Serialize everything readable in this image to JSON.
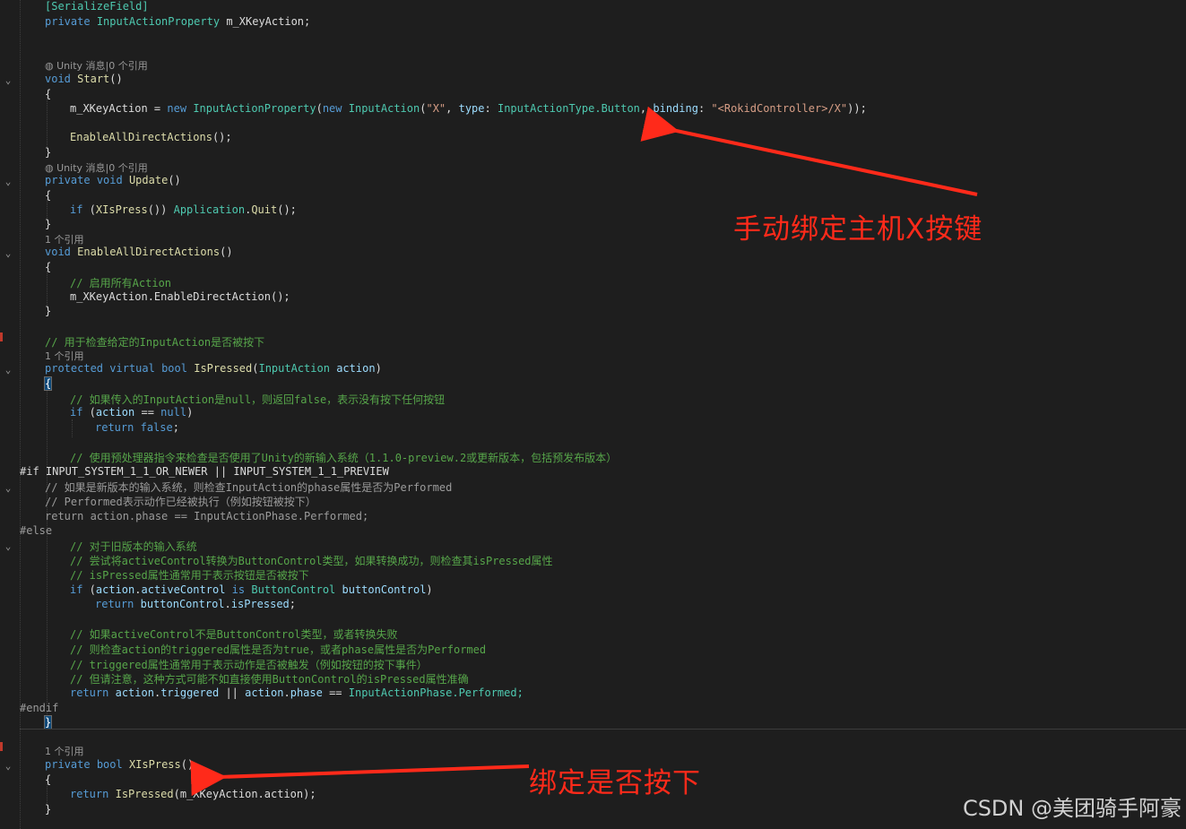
{
  "editor": {
    "line1": "[SerializeField]",
    "line2_kw": "private",
    "line2_type": "InputActionProperty",
    "line2_name": "m_XKeyAction;",
    "lens_unity": "Unity 消息|0 个引用",
    "lens_ref1": "1 个引用",
    "start_kw": "void",
    "start_name": "Start",
    "brace_open": "{",
    "brace_close": "}",
    "assign_lhs": "m_XKeyAction",
    "assign_eq": " = ",
    "kw_new": "new",
    "type_iap": "InputActionProperty",
    "type_ia": "InputAction",
    "str_x": "\"X\"",
    "param_type": "type",
    "enum_button": "InputActionType.Button",
    "param_binding": "binding",
    "str_binding": "\"<RokidController>/X\"",
    "call_enable_all": "EnableAllDirectActions",
    "update_private": "private",
    "update_void": "void",
    "update_name": "Update",
    "if_kw": "if",
    "xispress_call": "XIsPress",
    "app_type": "Application",
    "quit": "Quit",
    "enable_all_void": "void",
    "enable_all_name": "EnableAllDirectActions",
    "comment_enable": "// 启用所有Action",
    "call_enable_direct": "m_XKeyAction.EnableDirectAction();",
    "comment_check": "// 用于检查给定的InputAction是否被按下",
    "protected_kw": "protected",
    "virtual_kw": "virtual",
    "bool_kw": "bool",
    "ispressed_name": "IsPressed",
    "param_action": "action",
    "comment_null": "// 如果传入的InputAction是null，则返回false，表示没有按下任何按钮",
    "null_kw": "null",
    "return_kw": "return",
    "false_kw": "false",
    "comment_preproc": "// 使用预处理器指令来检查是否使用了Unity的新输入系统（1.1.0-preview.2或更新版本，包括预发布版本）",
    "pp_if": "#if INPUT_SYSTEM_1_1_OR_NEWER || INPUT_SYSTEM_1_1_PREVIEW",
    "dim_comment1": "// 如果是新版本的输入系统，则检查InputAction的phase属性是否为Performed",
    "dim_comment2": "// Performed表示动作已经被执行（例如按钮被按下）",
    "dim_return": "return action.phase == InputActionPhase.Performed;",
    "pp_else": "#else",
    "comment_old1": "// 对于旧版本的输入系统",
    "comment_old2": "// 尝试将activeControl转换为ButtonControl类型，如果转换成功，则检查其isPressed属性",
    "comment_old3": "// isPressed属性通常用于表示按钮是否被按下",
    "active_control": "activeControl",
    "is_kw": "is",
    "button_control_type": "ButtonControl",
    "button_control_var": "buttonControl",
    "is_pressed_prop": "isPressed",
    "comment_old4": "// 如果activeControl不是ButtonControl类型，或者转换失败",
    "comment_old5": "// 则检查action的triggered属性是否为true，或者phase属性是否为Performed",
    "comment_old6": "// triggered属性通常用于表示动作是否被触发（例如按钮的按下事件）",
    "comment_old7": "// 但请注意，这种方式可能不如直接使用ButtonControl的isPressed属性准确",
    "triggered_prop": "triggered",
    "phase_prop": "phase",
    "enum_performed": "InputActionPhase.Performed;",
    "pp_endif": "#endif",
    "xispress_private": "private",
    "xispress_bool": "bool",
    "xispress_name": "XIsPress",
    "return_ispressed": "IsPressed",
    "return_arg": "m_XKeyAction.action"
  },
  "annotations": {
    "top": "手动绑定主机X按键",
    "bottom": "绑定是否按下",
    "color": "#ff2a1a"
  },
  "watermark": "CSDN @美团骑手阿豪",
  "colors": {
    "background": "#1e1e1e",
    "keyword": "#569cd6",
    "type": "#4ec9b0",
    "method": "#dcdcaa",
    "string": "#d69d85",
    "comment": "#57a64a"
  }
}
